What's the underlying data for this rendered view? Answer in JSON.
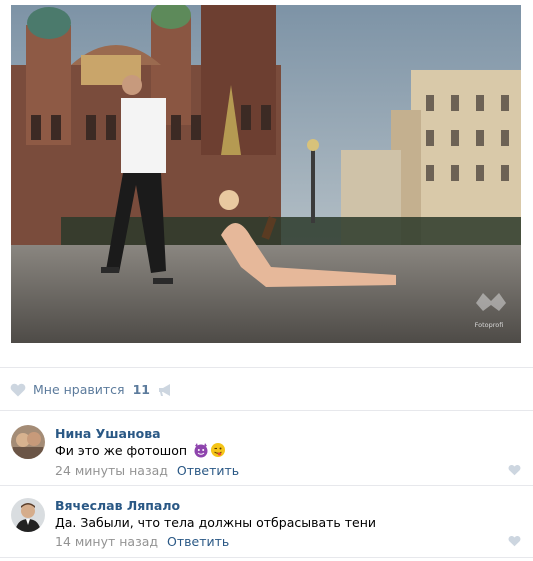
{
  "post": {
    "photo": {
      "watermark": "Fotoprofi"
    },
    "likes": {
      "label": "Мне нравится",
      "count": "11"
    }
  },
  "comments": [
    {
      "author": "Нина Ушанова",
      "text": "Фи это же фотошоп",
      "emoji": [
        "smiling-imp-icon",
        "winking-tongue-face-icon"
      ],
      "time": "24 минуты назад",
      "reply_label": "Ответить"
    },
    {
      "author": "Вячеслав Ляпало",
      "text": "Да. Забыли, что тела должны отбрасывать тени",
      "time": "14 минут назад",
      "reply_label": "Ответить"
    }
  ],
  "colors": {
    "link": "#2a5885",
    "like_text": "#5c7b9c",
    "meta": "#939393",
    "divider": "#e7e8ec",
    "icon": "#cdd6e0"
  }
}
